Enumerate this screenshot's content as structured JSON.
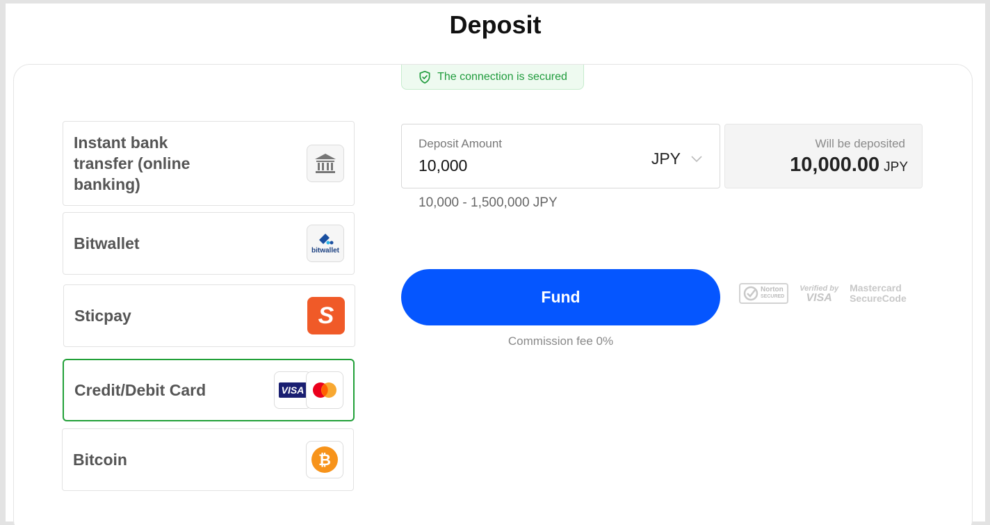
{
  "page": {
    "title": "Deposit"
  },
  "security": {
    "text": "The connection is secured",
    "icon": "shield-check-icon"
  },
  "payment_methods": [
    {
      "label": "Instant bank transfer (online banking)",
      "icon": "bank-icon",
      "selected": false
    },
    {
      "label": "Bitwallet",
      "icon": "bitwallet-logo",
      "icon_text": "bitwallet",
      "selected": false
    },
    {
      "label": "Sticpay",
      "icon": "sticpay-logo",
      "icon_text": "S",
      "selected": false
    },
    {
      "label": "Credit/Debit Card",
      "icon": "visa-mastercard-logos",
      "icon_text": "VISA",
      "selected": true
    },
    {
      "label": "Bitcoin",
      "icon": "bitcoin-icon",
      "selected": false
    }
  ],
  "deposit": {
    "amount_label": "Deposit Amount",
    "amount_value": "10,000",
    "currency": "JPY",
    "will_be_deposited_label": "Will be deposited",
    "will_be_deposited_value": "10,000.00",
    "will_be_deposited_currency": "JPY",
    "range": "10,000 - 1,500,000 JPY"
  },
  "fund": {
    "button_label": "Fund",
    "commission": "Commission fee 0%"
  },
  "trust": {
    "norton_line1": "Norton",
    "norton_line2": "SECURED",
    "vbv_line1": "Verified by",
    "vbv_line2": "VISA",
    "mc_line1": "Mastercard",
    "mc_line2": "SecureCode"
  },
  "colors": {
    "accent": "#0556ff",
    "selected_border": "#21a038",
    "secure_green": "#1f9b3c"
  }
}
